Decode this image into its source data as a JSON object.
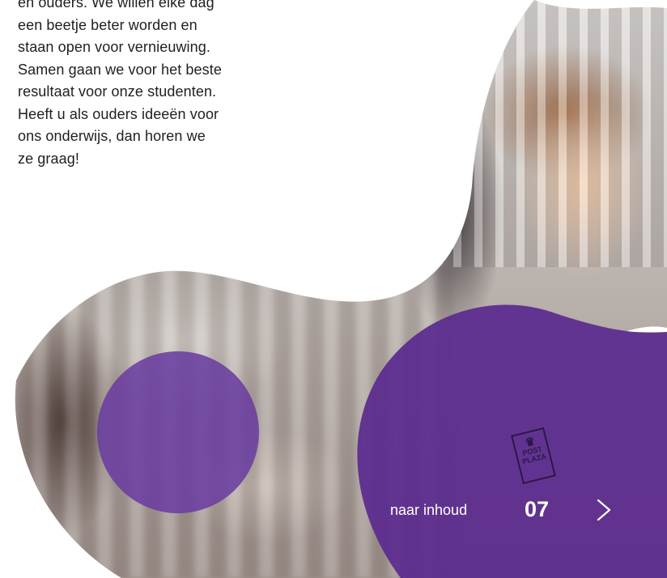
{
  "intro": {
    "lines": [
      "en ouders. We willen elke dag",
      "een beetje beter worden en",
      "staan open voor vernieuwing.",
      "Samen gaan we voor het beste",
      "resultaat voor onze studenten.",
      "Heeft u als ouders ideeën voor",
      "ons onderwijs, dan horen we",
      "ze graag!"
    ]
  },
  "badge": {
    "text": "POST PLAZA",
    "icon": "chef-hat-icon"
  },
  "footer_nav": {
    "link_label": "naar inhoud",
    "page_number": "07",
    "next_icon": "chevron-right-icon"
  },
  "colors": {
    "purple": "#5b2b8f",
    "text": "#1f1f24",
    "white": "#ffffff"
  }
}
